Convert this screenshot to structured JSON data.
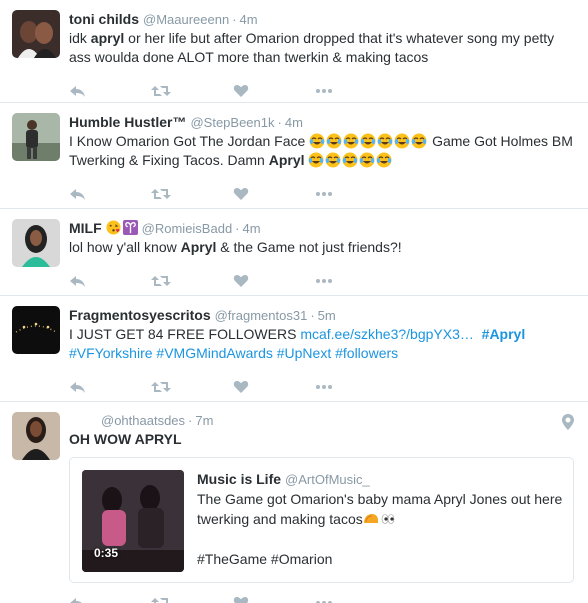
{
  "tweets": [
    {
      "name": "toni childs",
      "handle": "@Maaureeenn",
      "time": "4m",
      "text_pre": "idk ",
      "text_bold": "apryl",
      "text_post": " or her life but after Omarion dropped that it's whatever song my petty ass woulda done ALOT more than twerkin & making tacos"
    },
    {
      "name": "Humble Hustler™",
      "handle": "@StepBeen1k",
      "time": "4m",
      "text_a": "I Know Omarion Got The Jordan Face ",
      "text_b": " Game Got Holmes BM Twerking & Fixing Tacos. Damn ",
      "text_bold": "Apryl"
    },
    {
      "name": "MILF",
      "handle": "@RomieisBadd",
      "time": "4m",
      "text_pre": "lol how y'all know ",
      "text_bold": "Apryl",
      "text_post": " & the Game not just friends?!"
    },
    {
      "name": "Fragmentosyescritos",
      "handle": "@fragmentos31",
      "time": "5m",
      "text_pre": "I JUST GET 84 FREE FOLLOWERS ",
      "link": "mcaf.ee/szkhe3?/bgpYX3…",
      "hashtag_bold": "#Apryl",
      "hashtags": "#VFYorkshire #VMGMindAwards #UpNext #followers"
    },
    {
      "name": "",
      "handle": "@ohthaatsdes",
      "time": "7m",
      "text_bold": "OH WOW APRYL",
      "card": {
        "name": "Music is Life",
        "handle": "@ArtOfMusic_",
        "text": "The Game got Omarion's baby mama Apryl Jones out here twerking and making tacos",
        "tags": "#TheGame #Omarion",
        "duration": "0:35"
      }
    }
  ],
  "icons": {
    "reply": "reply-icon",
    "retweet": "retweet-icon",
    "like": "heart-icon",
    "more": "more-icon",
    "location": "location-pin-icon"
  },
  "colors": {
    "text": "#292f33",
    "muted": "#8899a6",
    "link": "#1b95e0",
    "icon": "#aab8c2",
    "border": "#e1e8ed"
  }
}
